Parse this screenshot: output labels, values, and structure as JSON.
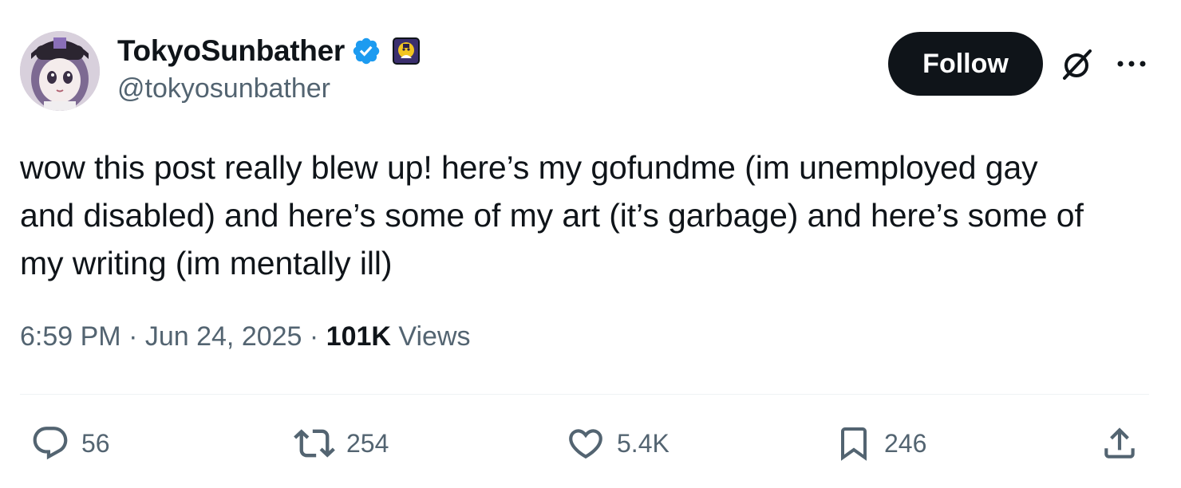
{
  "author": {
    "display_name": "TokyoSunbather",
    "handle": "@tokyosunbather"
  },
  "icons": {
    "verified": "verified-badge-icon",
    "affiliate": "affiliate-badge-icon",
    "grok": "grok-icon",
    "more": "more-options-icon",
    "reply": "reply-icon",
    "retweet": "retweet-icon",
    "like": "like-icon",
    "bookmark": "bookmark-icon",
    "share": "share-icon"
  },
  "colors": {
    "verified_blue": "#1d9bf0",
    "text_primary": "#0f1419",
    "text_secondary": "#536471",
    "follow_bg": "#0f1419"
  },
  "follow_label": "Follow",
  "tweet": {
    "line1": "wow this post really blew up! here’s my gofundme (im unemployed gay",
    "line2": "and disabled) and here’s some of my art (it’s garbage) and here’s some of",
    "line3": "my writing (im mentally ill)"
  },
  "meta": {
    "time": "6:59 PM",
    "separator": " · ",
    "date": "Jun 24, 2025",
    "views_count": "101K",
    "views_label": "Views"
  },
  "actions": {
    "replies": "56",
    "retweets": "254",
    "likes": "5.4K",
    "bookmarks": "246"
  }
}
